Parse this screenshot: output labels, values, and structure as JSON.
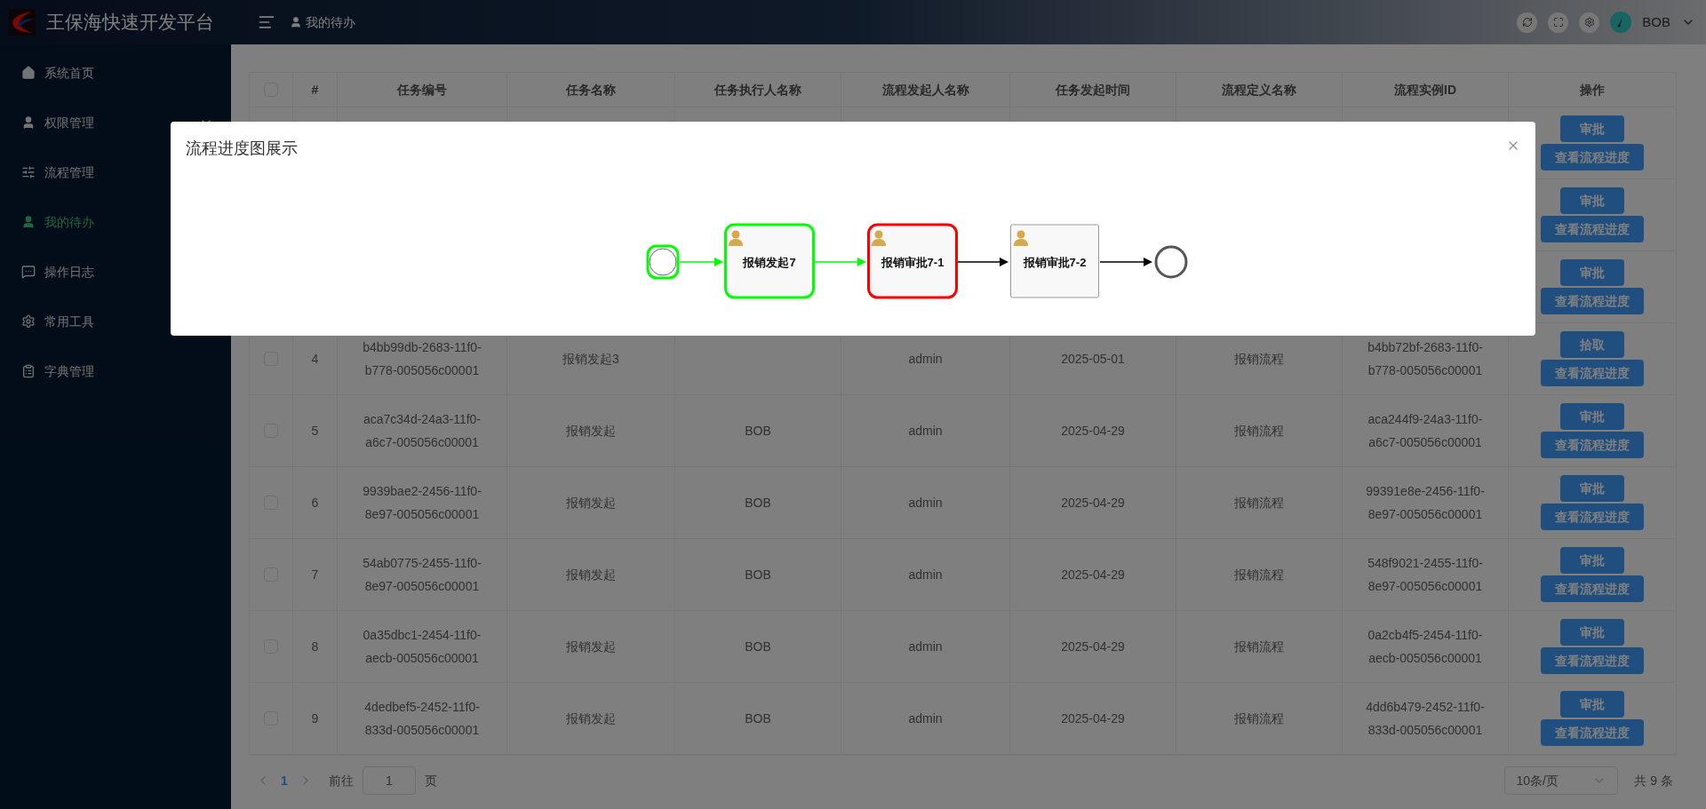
{
  "app": {
    "title": "王保海快速开发平台"
  },
  "header": {
    "breadcrumb": "我的待办",
    "user": "BOB"
  },
  "sidebar": {
    "items": [
      {
        "kind": "home",
        "label": "系统首页",
        "selected": false
      },
      {
        "kind": "user",
        "label": "权限管理",
        "selected": false,
        "expanded": false
      },
      {
        "kind": "sliders",
        "label": "流程管理",
        "selected": false
      },
      {
        "kind": "user",
        "label": "我的待办",
        "selected": true
      },
      {
        "kind": "chat",
        "label": "操作日志",
        "selected": false
      },
      {
        "kind": "gear",
        "label": "常用工具",
        "selected": false
      },
      {
        "kind": "clipboard",
        "label": "字典管理",
        "selected": false
      }
    ]
  },
  "table": {
    "columns": [
      "#",
      "任务编号",
      "任务名称",
      "任务执行人名称",
      "流程发起人名称",
      "任务发起时间",
      "流程定义名称",
      "流程实例ID",
      "操作"
    ],
    "header_checkbox": {
      "checked": false
    },
    "rows": [
      {
        "actions": [
          "审批",
          "查看流程进度"
        ]
      },
      {
        "actions": [
          "审批",
          "查看流程进度"
        ]
      },
      {
        "actions": [
          "审批",
          "查看流程进度"
        ]
      },
      {
        "checked": false,
        "cells": [
          "4",
          "b4bb99db-2683-11f0-b778-005056c00001",
          "报销发起3",
          "",
          "admin",
          "2025-05-01",
          "报销流程",
          "b4bb72bf-2683-11f0-b778-005056c00001"
        ],
        "actions": [
          "拾取",
          "查看流程进度"
        ]
      },
      {
        "checked": false,
        "cells": [
          "5",
          "aca7c34d-24a3-11f0-a6c7-005056c00001",
          "报销发起",
          "BOB",
          "admin",
          "2025-04-29",
          "报销流程",
          "aca244f9-24a3-11f0-a6c7-005056c00001"
        ],
        "actions": [
          "审批",
          "查看流程进度"
        ]
      },
      {
        "checked": false,
        "cells": [
          "6",
          "9939bae2-2456-11f0-8e97-005056c00001",
          "报销发起",
          "BOB",
          "admin",
          "2025-04-29",
          "报销流程",
          "99391e8e-2456-11f0-8e97-005056c00001"
        ],
        "actions": [
          "审批",
          "查看流程进度"
        ]
      },
      {
        "checked": false,
        "cells": [
          "7",
          "54ab0775-2455-11f0-8e97-005056c00001",
          "报销发起",
          "BOB",
          "admin",
          "2025-04-29",
          "报销流程",
          "548f9021-2455-11f0-8e97-005056c00001"
        ],
        "actions": [
          "审批",
          "查看流程进度"
        ]
      },
      {
        "checked": false,
        "cells": [
          "8",
          "0a35dbc1-2454-11f0-aecb-005056c00001",
          "报销发起",
          "BOB",
          "admin",
          "2025-04-29",
          "报销流程",
          "0a2cb4f5-2454-11f0-aecb-005056c00001"
        ],
        "actions": [
          "审批",
          "查看流程进度"
        ]
      },
      {
        "checked": false,
        "cells": [
          "9",
          "4dedbef5-2452-11f0-833d-005056c00001",
          "报销发起",
          "BOB",
          "admin",
          "2025-04-29",
          "报销流程",
          "4dd6b479-2452-11f0-833d-005056c00001"
        ],
        "actions": [
          "审批",
          "查看流程进度"
        ]
      }
    ]
  },
  "pagination": {
    "pages": [
      {
        "label": "1",
        "selected": true
      }
    ],
    "goto_label": "前往",
    "goto_value": "1",
    "goto_suffix": "页",
    "page_size": "10条/页",
    "total": "共 9 条"
  },
  "modal": {
    "title": "流程进度图展示",
    "nodes": [
      {
        "kind": "start",
        "done": true,
        "current": false
      },
      {
        "kind": "task",
        "label": "报销发起7",
        "done": true,
        "current": false
      },
      {
        "kind": "task",
        "label": "报销审批7-1",
        "done": false,
        "current": true
      },
      {
        "kind": "task",
        "label": "报销审批7-2",
        "done": false,
        "current": false
      },
      {
        "kind": "end",
        "done": false,
        "current": false
      }
    ],
    "edges": [
      {
        "done": true
      },
      {
        "done": true
      },
      {
        "done": false
      },
      {
        "done": false
      }
    ]
  }
}
